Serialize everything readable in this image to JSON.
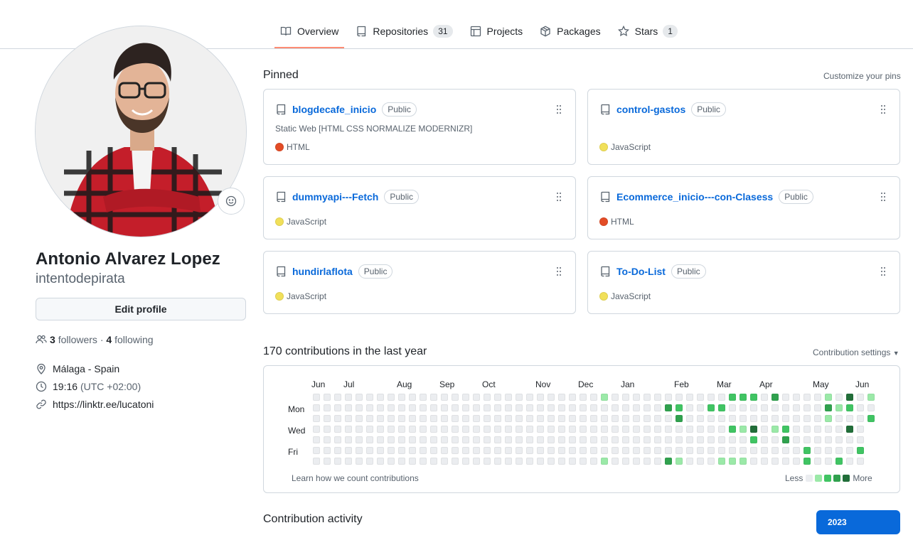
{
  "nav": {
    "tabs": [
      {
        "label": "Overview",
        "icon": "book-icon",
        "count": null,
        "selected": true
      },
      {
        "label": "Repositories",
        "icon": "repo-icon",
        "count": "31",
        "selected": false
      },
      {
        "label": "Projects",
        "icon": "table-icon",
        "count": null,
        "selected": false
      },
      {
        "label": "Packages",
        "icon": "package-icon",
        "count": null,
        "selected": false
      },
      {
        "label": "Stars",
        "icon": "star-icon",
        "count": "1",
        "selected": false
      }
    ]
  },
  "profile": {
    "full_name": "Antonio Alvarez Lopez",
    "username": "intentodepirata",
    "edit_label": "Edit profile",
    "followers_count": "3",
    "followers_label": "followers",
    "separator": "·",
    "following_count": "4",
    "following_label": "following",
    "location": "Málaga - Spain",
    "time": "19:16",
    "timezone": "(UTC +02:00)",
    "link": "https://linktr.ee/lucatoni"
  },
  "pinned": {
    "title": "Pinned",
    "customize_label": "Customize your pins",
    "repos": [
      {
        "name": "blogdecafe_inicio",
        "visibility": "Public",
        "description": "Static Web [HTML CSS NORMALIZE MODERNIZR]",
        "language": "HTML",
        "language_color": "#e34c26"
      },
      {
        "name": "control-gastos",
        "visibility": "Public",
        "description": "",
        "language": "JavaScript",
        "language_color": "#f1e05a"
      },
      {
        "name": "dummyapi---Fetch",
        "visibility": "Public",
        "description": "",
        "language": "JavaScript",
        "language_color": "#f1e05a"
      },
      {
        "name": "Ecommerce_inicio---con-Clasess",
        "visibility": "Public",
        "description": "",
        "language": "HTML",
        "language_color": "#e34c26"
      },
      {
        "name": "hundirlaflota",
        "visibility": "Public",
        "description": "",
        "language": "JavaScript",
        "language_color": "#f1e05a"
      },
      {
        "name": "To-Do-List",
        "visibility": "Public",
        "description": "",
        "language": "JavaScript",
        "language_color": "#f1e05a"
      }
    ]
  },
  "contributions": {
    "title": "170 contributions in the last year",
    "settings_label": "Contribution settings",
    "months": [
      "Jun",
      "Jul",
      "Aug",
      "Sep",
      "Oct",
      "Nov",
      "Dec",
      "Jan",
      "Feb",
      "Mar",
      "Apr",
      "May",
      "Jun"
    ],
    "day_labels": [
      "Mon",
      "Wed",
      "Fri"
    ],
    "learn_label": "Learn how we count contributions",
    "legend_less": "Less",
    "legend_more": "More",
    "level_colors": [
      "#ebedf0",
      "#9be9a8",
      "#40c463",
      "#30a14e",
      "#216e39"
    ]
  },
  "activity": {
    "title": "Contribution activity",
    "year": "2023"
  }
}
